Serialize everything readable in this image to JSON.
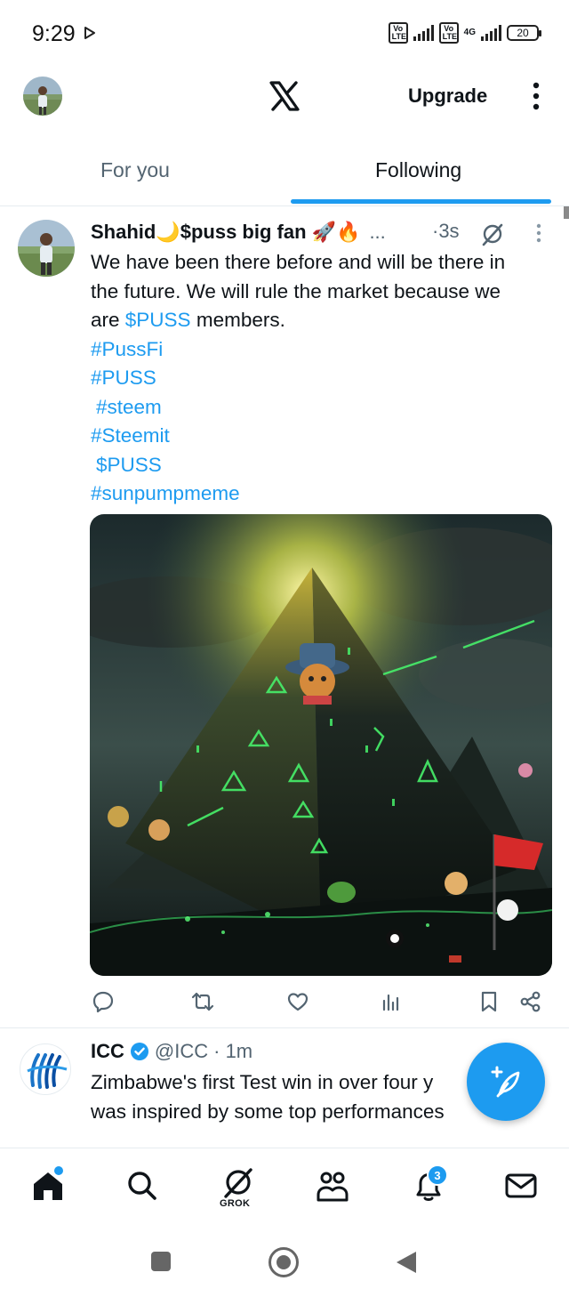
{
  "status_bar": {
    "time": "9:29",
    "network_1": "Vo LTE",
    "network_2": "Vo LTE",
    "network_type": "4G",
    "battery": "20"
  },
  "header": {
    "logo_icon": "x-logo-icon",
    "upgrade_label": "Upgrade"
  },
  "tabs": [
    {
      "label": "For you",
      "active": false
    },
    {
      "label": "Following",
      "active": true
    }
  ],
  "post": {
    "author": "Shahid🌙$puss big fan 🚀🔥",
    "truncation": "...",
    "time": "·3s",
    "text_line1": "We have been there before and will be there in",
    "text_line2": "the future. We will rule the market because we",
    "text_line3_prefix": "are ",
    "cashtag": "$PUSS",
    "text_line3_suffix": " members.",
    "hashtags": [
      "#PussFi",
      "#PUSS",
      "#steem",
      "#Steemit",
      "$PUSS",
      "#sunpumpmeme"
    ]
  },
  "post2": {
    "author": "ICC",
    "handle": "@ICC",
    "time": "· 1m",
    "text_line1": "Zimbabwe's first Test win in over four y",
    "text_line2": "was inspired by some top performances"
  },
  "bottom_nav": {
    "grok_label": "GROK",
    "notification_count": "3"
  },
  "colors": {
    "accent": "#1d9bf0",
    "text": "#0f1419",
    "muted": "#536471"
  }
}
